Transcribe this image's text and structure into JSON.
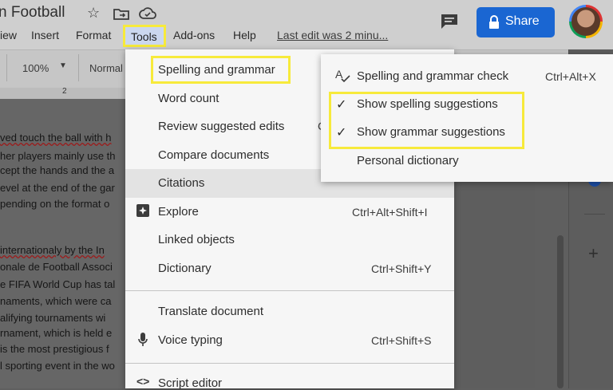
{
  "header": {
    "doc_title": "n Football",
    "menus": [
      "iew",
      "Insert",
      "Format",
      "Tools",
      "Add-ons",
      "Help"
    ],
    "last_edit": "Last edit was 2 minu...",
    "share_label": "Share"
  },
  "toolbar": {
    "zoom": "100%",
    "style": "Normal",
    "ruler_mark": "2"
  },
  "document": {
    "lines_top": [
      "ved touch the ball with h",
      "her players mainly use th",
      "cept the hands and the a",
      "evel at the end of the gar",
      "pending on the format o"
    ],
    "lines_bottom": [
      " internationaly by the In",
      "onale de Football Associ",
      "e FIFA World Cup has tal",
      "naments, which were ca",
      "alifying tournaments wi",
      "rnament, which is held e",
      " is the most prestigious f",
      "l sporting event in the wo"
    ]
  },
  "tools_menu": {
    "items": [
      {
        "label": "Spelling and grammar",
        "shortcut": ""
      },
      {
        "label": "Word count",
        "shortcut": ""
      },
      {
        "label": "Review suggested edits",
        "shortcut": "C"
      },
      {
        "label": "Compare documents",
        "shortcut": ""
      },
      {
        "label": "Citations",
        "shortcut": ""
      },
      {
        "label": "Explore",
        "shortcut": "Ctrl+Alt+Shift+I"
      },
      {
        "label": "Linked objects",
        "shortcut": ""
      },
      {
        "label": "Dictionary",
        "shortcut": "Ctrl+Shift+Y"
      },
      {
        "label": "Translate document",
        "shortcut": ""
      },
      {
        "label": "Voice typing",
        "shortcut": "Ctrl+Shift+S"
      },
      {
        "label": "Script editor",
        "shortcut": ""
      }
    ]
  },
  "spelling_submenu": {
    "items": [
      {
        "label": "Spelling and grammar check",
        "shortcut": "Ctrl+Alt+X"
      },
      {
        "label": "Show spelling suggestions",
        "checked": true
      },
      {
        "label": "Show grammar suggestions",
        "checked": true
      },
      {
        "label": "Personal dictionary"
      }
    ]
  },
  "colors": {
    "highlight": "#f7ea3b",
    "share": "#1a66d2"
  }
}
